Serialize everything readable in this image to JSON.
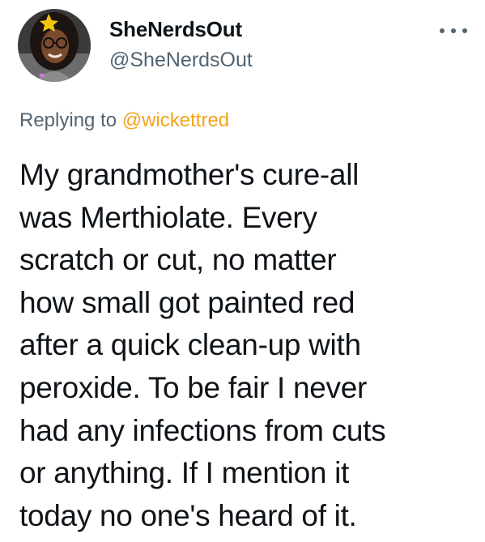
{
  "tweet": {
    "display_name": "SheNerdsOut",
    "handle": "@SheNerdsOut",
    "reply_prefix": "Replying to",
    "reply_mention": "@wickettred",
    "text": "My grandmother's cure-all\nwas Merthiolate. Every\nscratch or cut, no matter\nhow small got painted red\nafter a quick clean-up with\nperoxide. To be fair I never\nhad any infections from cuts\nor anything. If I mention it\ntoday no one's heard of it.",
    "more_icon": "more-horizontal-icon",
    "accent_color": "#f4a31a",
    "secondary_text_color": "#536471"
  }
}
